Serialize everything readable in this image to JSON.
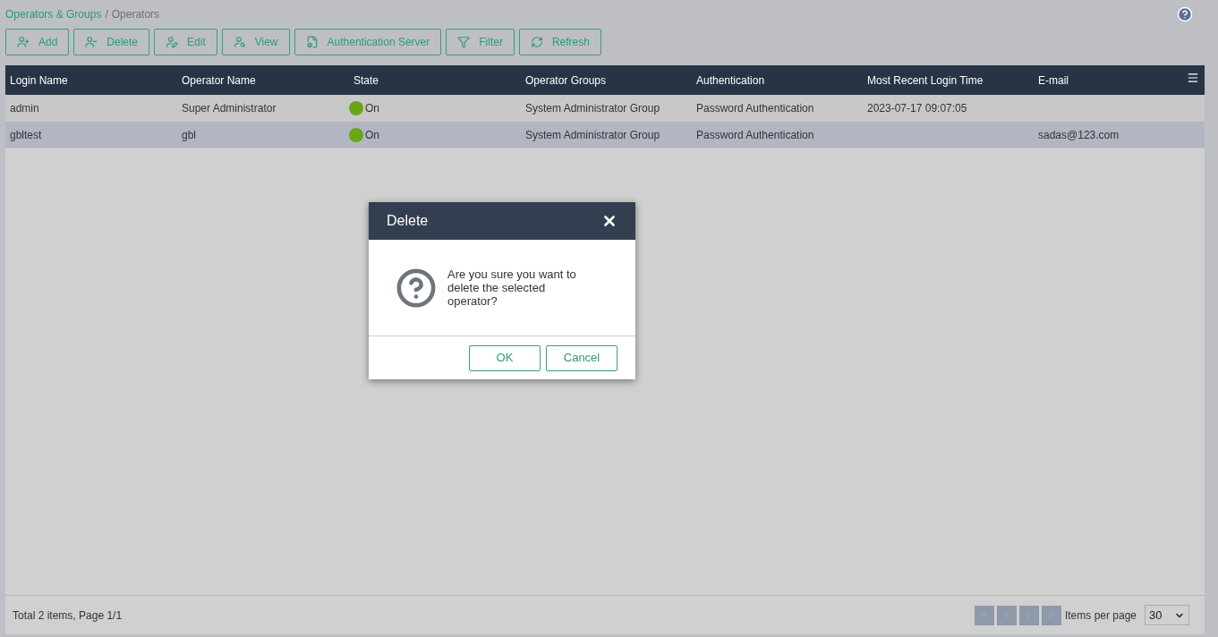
{
  "breadcrumb": [
    {
      "label": "Operators & Groups",
      "link": true
    },
    {
      "label": "/",
      "link": false
    },
    {
      "label": "Operators",
      "link": false
    }
  ],
  "toolbar": [
    {
      "kind": "add",
      "label": "Add"
    },
    {
      "kind": "delete",
      "label": "Delete"
    },
    {
      "kind": "edit",
      "label": "Edit"
    },
    {
      "kind": "view",
      "label": "View"
    },
    {
      "kind": "server",
      "label": "Authentication Server"
    },
    {
      "kind": "filter",
      "label": "Filter"
    },
    {
      "kind": "refresh",
      "label": "Refresh"
    }
  ],
  "table": {
    "columns": [
      "Login Name",
      "Operator Name",
      "State",
      "Operator Groups",
      "Authentication",
      "Most Recent Login Time",
      "E-mail"
    ],
    "rows": [
      {
        "selected": false,
        "cells": [
          "admin",
          "Super Administrator",
          "On",
          "System Administrator Group",
          "Password Authentication",
          "2023-07-17 09:07:05",
          ""
        ]
      },
      {
        "selected": true,
        "cells": [
          "gbltest",
          "gbl",
          "On",
          "System Administrator Group",
          "Password Authentication",
          "",
          "sadas@123.com"
        ]
      }
    ]
  },
  "footer": {
    "summary": "Total 2 items, Page 1/1",
    "per_page_label": "Items per page",
    "per_page": "30"
  },
  "dialog": {
    "title": "Delete",
    "message": "Are you sure you want to delete the selected operator?",
    "buttons": [
      "OK",
      "Cancel"
    ]
  }
}
